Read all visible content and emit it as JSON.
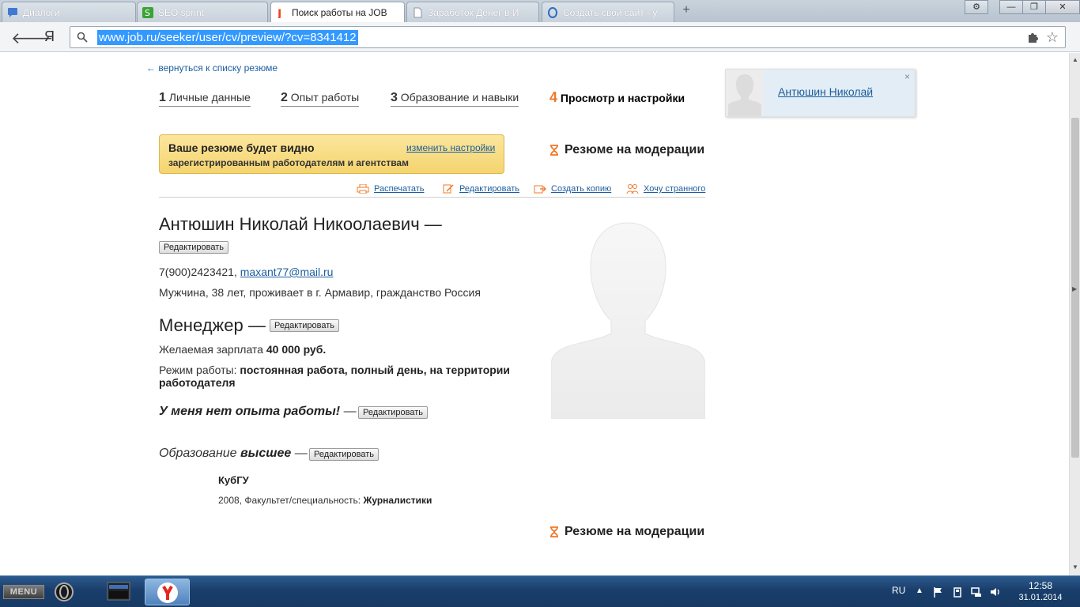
{
  "browser": {
    "tabs": [
      {
        "label": "Диалоги",
        "active": false
      },
      {
        "label": "SEO sprint",
        "active": false
      },
      {
        "label": "Поиск работы на JOB",
        "active": true
      },
      {
        "label": "Заработок Денег в И",
        "active": false
      },
      {
        "label": "Создать свой сайт - у",
        "active": false
      }
    ],
    "address": "www.job.ru/seeker/user/cv/preview/?cv=8341412",
    "yandex_button": "Я"
  },
  "page": {
    "back_link": "← вернуться к списку резюме",
    "steps": [
      {
        "num": "1",
        "label": "Личные данные"
      },
      {
        "num": "2",
        "label": "Опыт работы"
      },
      {
        "num": "3",
        "label": "Образование и навыки"
      },
      {
        "num": "4",
        "label": "Просмотр и настройки"
      }
    ],
    "visibility": {
      "title": "Ваше резюме будет видно",
      "subtitle": "зарегистрированным работодателям и агентствам",
      "settings_link": "изменить настройки"
    },
    "moderation_status": "Резюме на модерации",
    "actions": [
      {
        "label": "Распечатать",
        "icon": "printer-icon"
      },
      {
        "label": "Редактировать",
        "icon": "edit-icon"
      },
      {
        "label": "Создать копию",
        "icon": "copy-icon"
      },
      {
        "label": "Хочу странного",
        "icon": "people-icon"
      }
    ],
    "profile": {
      "full_name": "Антюшин Николай Никоолаевич —",
      "edit_label": "Редактировать",
      "phone": "7(900)2423421,",
      "email": "maxant77@mail.ru",
      "details": "Мужчина, 38 лет, проживает в г. Армавир, гражданство Россия"
    },
    "position": {
      "title": "Менеджер —",
      "salary_label": "Желаемая зарплата",
      "salary_value": "40 000 руб.",
      "schedule_label": "Режим работы:",
      "schedule_value_line1": "постоянная работа, полный день, на территории",
      "schedule_value_line2": "работодателя"
    },
    "experience": {
      "text": "У меня нет опыта работы!",
      "dash": "—"
    },
    "education": {
      "label": "Образование",
      "level": "высшее",
      "dash": "—",
      "institution": "КубГУ",
      "year_faculty": "2008, Факультет/специальность:",
      "specialty": "Журналистики"
    },
    "user_card": {
      "name": "Антюшин Николай",
      "close": "×"
    }
  },
  "taskbar": {
    "menu_label": "MENU",
    "language": "RU",
    "time": "12:58",
    "date": "31.01.2014"
  }
}
